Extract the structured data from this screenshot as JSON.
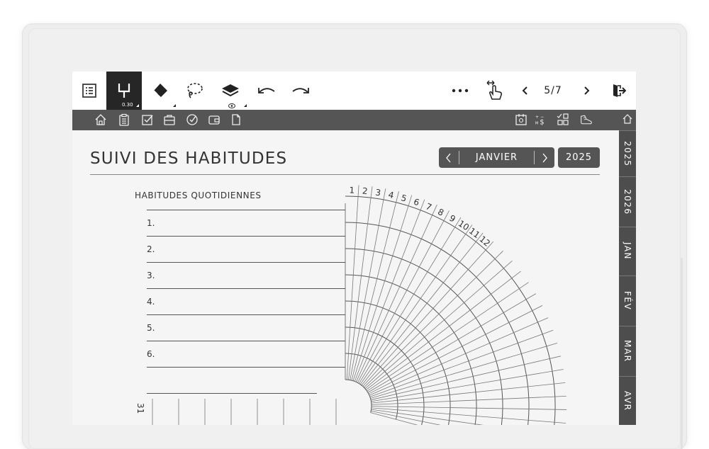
{
  "toolbar": {
    "pen_size": "0.30",
    "page_indicator": "5/7",
    "icons": [
      "toc-icon",
      "pen-icon",
      "eraser-icon",
      "lasso-icon",
      "layers-icon",
      "undo-icon",
      "redo-icon",
      "more-icon",
      "swipe-icon",
      "prev-page-icon",
      "next-page-icon",
      "exit-icon"
    ]
  },
  "navbar": {
    "left_icons": [
      "home-icon",
      "clipboard-icon",
      "checkbox-icon",
      "briefcase-icon",
      "goal-icon",
      "wallet-icon",
      "document-icon"
    ],
    "right_icons": [
      "daily-calendar-icon",
      "finance-icon",
      "checklist-grid-icon",
      "sneaker-icon"
    ]
  },
  "side_tabs": [
    {
      "label": "home-icon"
    },
    {
      "label": "2025"
    },
    {
      "label": "2026"
    },
    {
      "label": "JAN"
    },
    {
      "label": "FÉV"
    },
    {
      "label": "MAR"
    },
    {
      "label": "AVR"
    }
  ],
  "page": {
    "title": "SUIVI DES HABITUDES",
    "month": "JANVIER",
    "year": "2025",
    "section_label": "HABITUDES QUOTIDIENNES",
    "habits": [
      {
        "num": "1."
      },
      {
        "num": "2."
      },
      {
        "num": "3."
      },
      {
        "num": "4."
      },
      {
        "num": "5."
      },
      {
        "num": "6."
      }
    ],
    "tracker_days": [
      "1",
      "2",
      "3",
      "4",
      "5",
      "6",
      "7",
      "8",
      "9",
      "10",
      "11",
      "12"
    ],
    "bottom_day": "31"
  }
}
